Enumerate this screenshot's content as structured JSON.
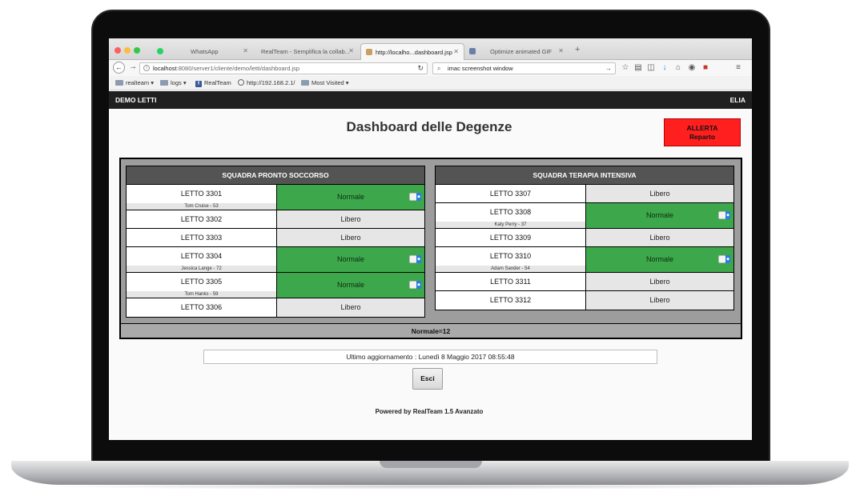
{
  "browser": {
    "tabs": [
      {
        "title": "WhatsApp"
      },
      {
        "title": "RealTeam - Semplifica la collab..."
      },
      {
        "title": "http://localho...dashboard.jsp"
      },
      {
        "title": "Optimize animated GIF"
      }
    ],
    "url_host": "localhost",
    "url_path": ":8080/server1/cliente/demo/letti/dashboard.jsp",
    "search_value": "imac screenshot window",
    "bookmarks": [
      "realteam",
      "logs",
      "RealTeam",
      "http://192.168.2.1/",
      "Most Visited"
    ]
  },
  "app": {
    "brand": "DEMO LETTI",
    "user": "ELIA",
    "title": "Dashboard delle Degenze",
    "alert_line1": "ALLERTA",
    "alert_line2": "Reparto",
    "footer_status": "Normale=12",
    "last_update": "Ultimo aggiornamento : Lunedì 8 Maggio 2017 08:55:48",
    "exit_label": "Esci",
    "powered_by": "Powered by RealTeam 1.5 Avanzato"
  },
  "squads": [
    {
      "name": "SQUADRA PRONTO SOCCORSO",
      "beds": [
        {
          "bed": "LETTO 3301",
          "patient": "Tom Cruise - 53",
          "status": "Normale"
        },
        {
          "bed": "LETTO 3302",
          "patient": "",
          "status": "Libero"
        },
        {
          "bed": "LETTO 3303",
          "patient": "",
          "status": "Libero"
        },
        {
          "bed": "LETTO 3304",
          "patient": "Jessica Lange - 72",
          "status": "Normale"
        },
        {
          "bed": "LETTO 3305",
          "patient": "Tom Hanks - 59",
          "status": "Normale"
        },
        {
          "bed": "LETTO 3306",
          "patient": "",
          "status": "Libero"
        }
      ]
    },
    {
      "name": "SQUADRA TERAPIA INTENSIVA",
      "beds": [
        {
          "bed": "LETTO 3307",
          "patient": "",
          "status": "Libero"
        },
        {
          "bed": "LETTO 3308",
          "patient": "Katy Perry - 37",
          "status": "Normale"
        },
        {
          "bed": "LETTO 3309",
          "patient": "",
          "status": "Libero"
        },
        {
          "bed": "LETTO 3310",
          "patient": "Adam Sander - 54",
          "status": "Normale"
        },
        {
          "bed": "LETTO 3311",
          "patient": "",
          "status": "Libero"
        },
        {
          "bed": "LETTO 3312",
          "patient": "",
          "status": "Libero"
        }
      ]
    }
  ],
  "colors": {
    "normale": "#3da84b",
    "libero": "#e6e6e6",
    "alert": "#ff1f1f",
    "header": "#202020"
  }
}
